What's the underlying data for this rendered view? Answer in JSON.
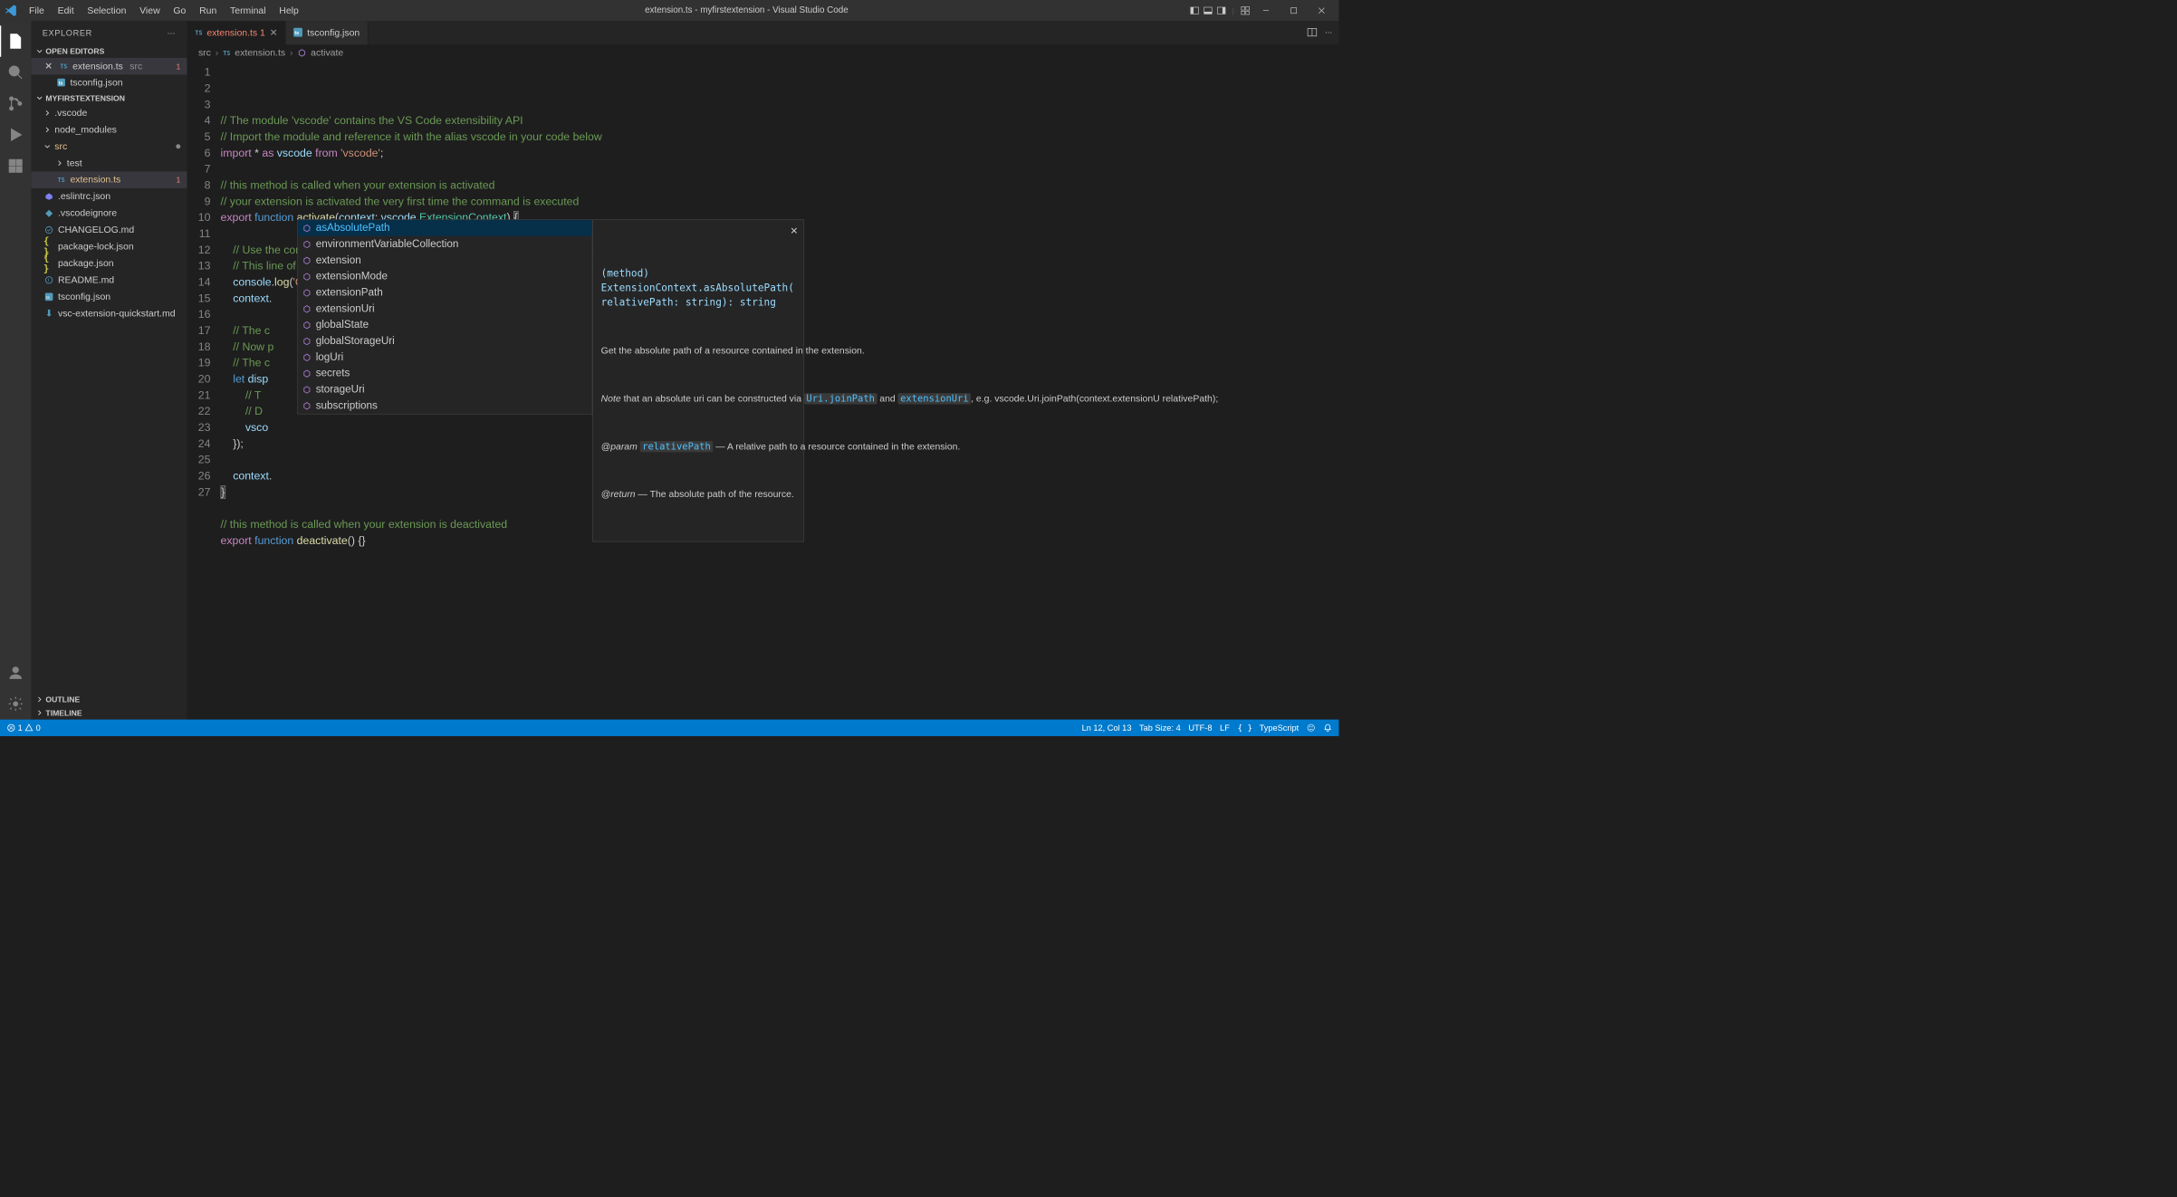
{
  "title": "extension.ts - myfirstextension - Visual Studio Code",
  "menu": [
    "File",
    "Edit",
    "Selection",
    "View",
    "Go",
    "Run",
    "Terminal",
    "Help"
  ],
  "explorer": {
    "title": "EXPLORER",
    "sections": {
      "openEditors": "OPEN EDITORS",
      "project": "MYFIRSTEXTENSION",
      "outline": "OUTLINE",
      "timeline": "TIMELINE"
    }
  },
  "openEditors": [
    {
      "name": "extension.ts",
      "desc": "src",
      "err": "1"
    },
    {
      "name": "tsconfig.json",
      "desc": ""
    }
  ],
  "tree": [
    {
      "name": ".vscode",
      "type": "dir",
      "depth": 0
    },
    {
      "name": "node_modules",
      "type": "dir",
      "depth": 0
    },
    {
      "name": "src",
      "type": "dir",
      "depth": 0,
      "mod": true,
      "open": true
    },
    {
      "name": "test",
      "type": "dir",
      "depth": 1
    },
    {
      "name": "extension.ts",
      "type": "ts",
      "depth": 1,
      "err": "1",
      "active": true
    },
    {
      "name": ".eslintrc.json",
      "type": "eslint",
      "depth": 0
    },
    {
      "name": ".vscodeignore",
      "type": "ign",
      "depth": 0
    },
    {
      "name": "CHANGELOG.md",
      "type": "md",
      "depth": 0
    },
    {
      "name": "package-lock.json",
      "type": "json",
      "depth": 0
    },
    {
      "name": "package.json",
      "type": "json",
      "depth": 0
    },
    {
      "name": "README.md",
      "type": "readme",
      "depth": 0
    },
    {
      "name": "tsconfig.json",
      "type": "tsjson",
      "depth": 0
    },
    {
      "name": "vsc-extension-quickstart.md",
      "type": "dl",
      "depth": 0
    }
  ],
  "tabs": [
    {
      "name": "extension.ts",
      "lang": "ts",
      "err": "1",
      "active": true
    },
    {
      "name": "tsconfig.json",
      "lang": "tsjson"
    }
  ],
  "breadcrumb": {
    "folder": "src",
    "file": "extension.ts",
    "symbol": "activate"
  },
  "code": [
    {
      "n": 1,
      "t": "comment",
      "s": "// The module 'vscode' contains the VS Code extensibility API"
    },
    {
      "n": 2,
      "t": "comment",
      "s": "// Import the module and reference it with the alias vscode in your code below"
    },
    {
      "n": 3,
      "t": "import"
    },
    {
      "n": 4,
      "t": "blank"
    },
    {
      "n": 5,
      "t": "comment",
      "s": "// this method is called when your extension is activated"
    },
    {
      "n": 6,
      "t": "comment",
      "s": "// your extension is activated the very first time the command is executed"
    },
    {
      "n": 7,
      "t": "export_activate"
    },
    {
      "n": 8,
      "t": "blank"
    },
    {
      "n": 9,
      "t": "comment",
      "s": "    // Use the console to output diagnostic information (console.log) and errors (console.error)",
      "i": 1
    },
    {
      "n": 10,
      "t": "comment",
      "s": "    // This line of code will only be executed once when your extension is activated",
      "i": 1
    },
    {
      "n": 11,
      "t": "console_log"
    },
    {
      "n": 12,
      "t": "context_dot"
    },
    {
      "n": 13,
      "t": "blank"
    },
    {
      "n": 14,
      "t": "comment",
      "s": "    // The c",
      "i": 1
    },
    {
      "n": 15,
      "t": "comment",
      "s": "    // Now p",
      "i": 1
    },
    {
      "n": 16,
      "t": "comment",
      "s": "    // The c",
      "i": 1
    },
    {
      "n": 17,
      "t": "let_disp"
    },
    {
      "n": 18,
      "t": "comment",
      "s": "        // T",
      "i": 2
    },
    {
      "n": 19,
      "t": "comment",
      "s": "        // D",
      "i": 2
    },
    {
      "n": 20,
      "t": "vsco",
      "i": 2
    },
    {
      "n": 21,
      "t": "close_arrow"
    },
    {
      "n": 22,
      "t": "blank"
    },
    {
      "n": 23,
      "t": "context2"
    },
    {
      "n": 24,
      "t": "close_brace"
    },
    {
      "n": 25,
      "t": "blank"
    },
    {
      "n": 26,
      "t": "comment",
      "s": "// this method is called when your extension is deactivated"
    },
    {
      "n": 27,
      "t": "export_deactivate"
    }
  ],
  "intellisense": {
    "items": [
      "asAbsolutePath",
      "environmentVariableCollection",
      "extension",
      "extensionMode",
      "extensionPath",
      "extensionUri",
      "globalState",
      "globalStorageUri",
      "logUri",
      "secrets",
      "storageUri",
      "subscriptions"
    ],
    "selected": 0,
    "doc": {
      "signature": "(method) ExtensionContext.asAbsolutePath(relativePath: string): string",
      "p1": "Get the absolute path of a resource contained in the extension.",
      "note_pre": "Note",
      "note_body": " that an absolute uri can be constructed via ",
      "tok1": "Uri.joinPath",
      "mid": " and ",
      "tok2": "extensionUri",
      "note_tail": ", e.g. vscode.Uri.joinPath(context.extensionU relativePath);",
      "param_label": "@param",
      "param_name": "relativePath",
      "param_body": " — A relative path to a resource contained in the extension.",
      "ret_label": "@return",
      "ret_body": " — The absolute path of the resource."
    }
  },
  "status": {
    "errors": "1",
    "warnings": "0",
    "ln": "Ln 12, Col 13",
    "tab": "Tab Size: 4",
    "enc": "UTF-8",
    "eol": "LF",
    "lang": "TypeScript",
    "bell": "🔔"
  }
}
